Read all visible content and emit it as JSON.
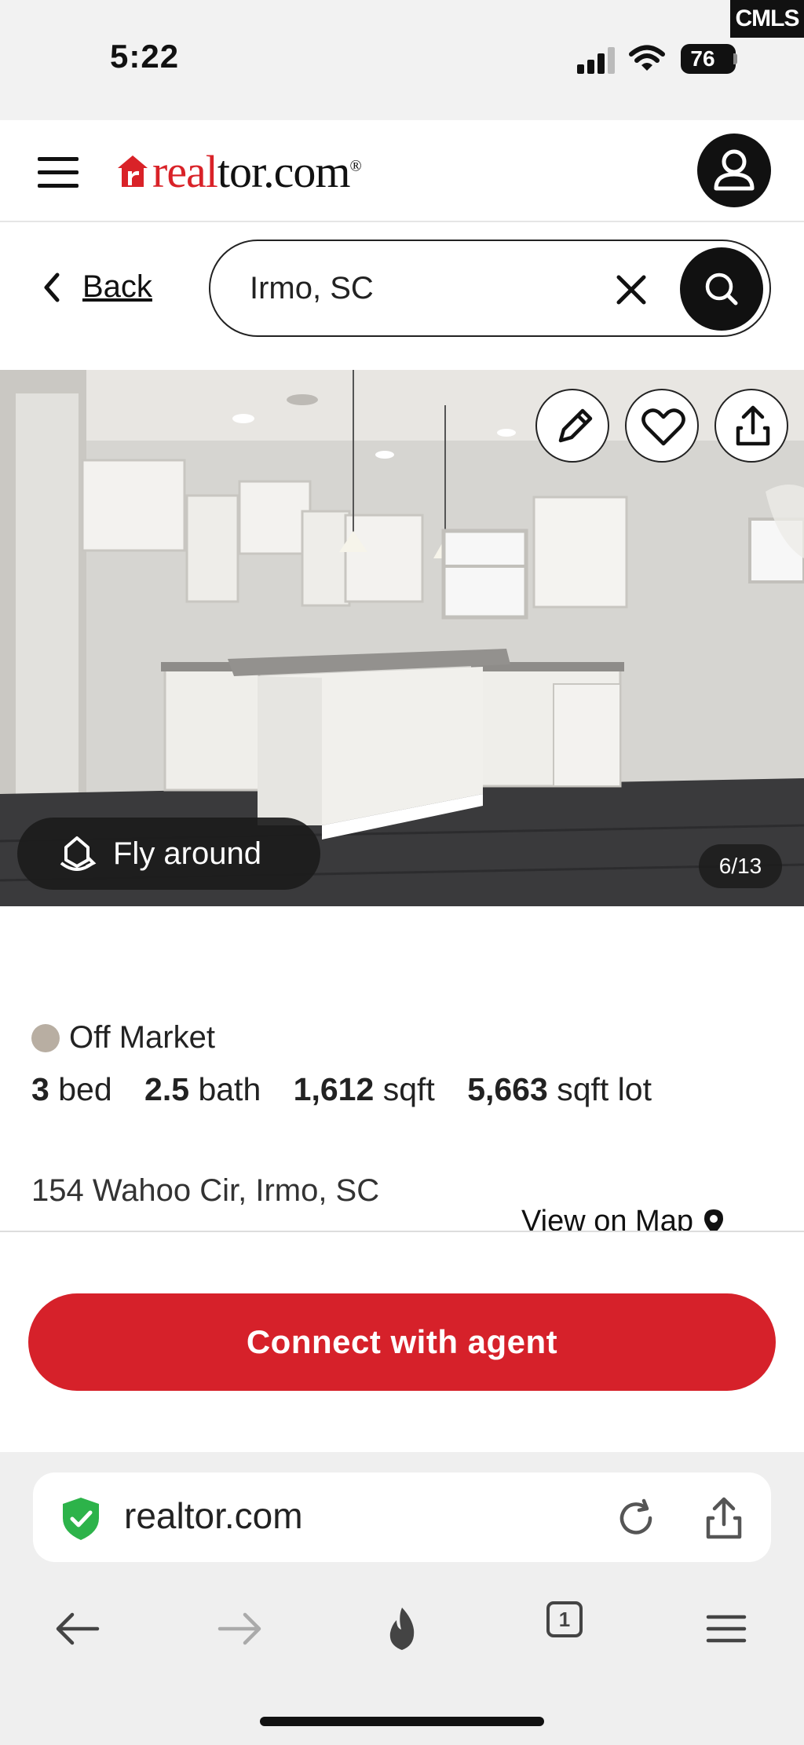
{
  "status_bar": {
    "time": "5:22",
    "battery": "76",
    "watermark": "CMLS"
  },
  "header": {
    "logo_text_red": "real",
    "logo_text_dark": "tor.com",
    "logo_mark": "®",
    "menu_icon": "hamburger-icon",
    "account_icon": "user-icon"
  },
  "search": {
    "back_label": "Back",
    "query": "Irmo, SC",
    "clear_icon": "close-icon",
    "submit_icon": "search-icon"
  },
  "gallery": {
    "actions": [
      "edit-icon",
      "heart-icon",
      "share-icon"
    ],
    "fly_around_label": "Fly around",
    "counter": "6/13"
  },
  "listing": {
    "status": "Off Market",
    "status_color": "#b8aea2",
    "facts": [
      {
        "value": "3",
        "unit": "bed"
      },
      {
        "value": "2.5",
        "unit": "bath"
      },
      {
        "value": "1,612",
        "unit": "sqft"
      },
      {
        "value": "5,663",
        "unit": "sqft lot"
      }
    ],
    "address": "154 Wahoo Cir, Irmo, SC",
    "map_link": "View on Map"
  },
  "cta": {
    "label": "Connect with agent",
    "color": "#d6212a"
  },
  "browser": {
    "url": "realtor.com",
    "tab_count": "1",
    "nav_icons": [
      "back-arrow-icon",
      "forward-arrow-icon",
      "flame-icon",
      "tabs-icon",
      "menu-icon"
    ]
  },
  "colors": {
    "brand_red": "#d92228",
    "secure_green": "#2db34a"
  }
}
